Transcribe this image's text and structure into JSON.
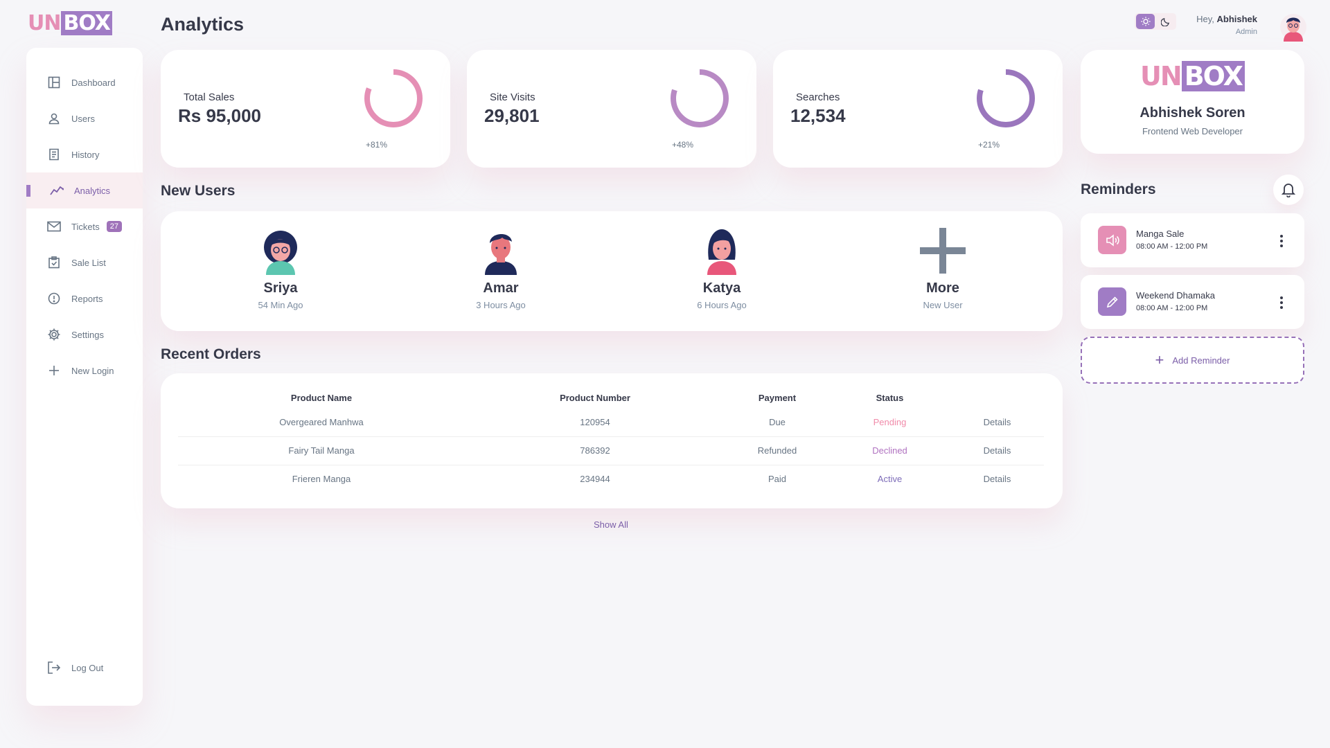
{
  "brand": {
    "un": "UN",
    "box": "BOX"
  },
  "sidebar": {
    "items": [
      {
        "label": "Dashboard",
        "icon": "dashboard-icon"
      },
      {
        "label": "Users",
        "icon": "user-icon"
      },
      {
        "label": "History",
        "icon": "receipt-icon"
      },
      {
        "label": "Analytics",
        "icon": "analytics-icon",
        "active": true
      },
      {
        "label": "Tickets",
        "icon": "mail-icon",
        "badge": "27"
      },
      {
        "label": "Sale List",
        "icon": "clipboard-icon"
      },
      {
        "label": "Reports",
        "icon": "report-icon"
      },
      {
        "label": "Settings",
        "icon": "gear-icon"
      },
      {
        "label": "New Login",
        "icon": "plus-icon"
      }
    ],
    "logout": "Log Out"
  },
  "page": {
    "title": "Analytics"
  },
  "stats": [
    {
      "label": "Total Sales",
      "value": "Rs 95,000",
      "percent": "+81%",
      "progress": 0.81,
      "color": "#e58fb5"
    },
    {
      "label": "Site Visits",
      "value": "29,801",
      "percent": "+48%",
      "progress": 0.8,
      "color": "#b88ac4"
    },
    {
      "label": "Searches",
      "value": "12,534",
      "percent": "+21%",
      "progress": 0.8,
      "color": "#9a76bd"
    }
  ],
  "new_users": {
    "title": "New Users",
    "items": [
      {
        "name": "Sriya",
        "time": "54 Min Ago"
      },
      {
        "name": "Amar",
        "time": "3 Hours Ago"
      },
      {
        "name": "Katya",
        "time": "6 Hours Ago"
      },
      {
        "name": "More",
        "time": "New User"
      }
    ]
  },
  "orders": {
    "title": "Recent Orders",
    "headers": [
      "Product Name",
      "Product Number",
      "Payment",
      "Status",
      ""
    ],
    "rows": [
      {
        "name": "Overgeared Manhwa",
        "number": "120954",
        "payment": "Due",
        "status": "Pending",
        "action": "Details"
      },
      {
        "name": "Fairy Tail Manga",
        "number": "786392",
        "payment": "Refunded",
        "status": "Declined",
        "action": "Details"
      },
      {
        "name": "Frieren Manga",
        "number": "234944",
        "payment": "Paid",
        "status": "Active",
        "action": "Details"
      }
    ],
    "show_all": "Show All"
  },
  "header": {
    "greeting": "Hey,",
    "user": "Abhishek",
    "role": "Admin"
  },
  "profile": {
    "name": "Abhishek Soren",
    "role": "Frontend Web Developer"
  },
  "reminders": {
    "title": "Reminders",
    "items": [
      {
        "title": "Manga Sale",
        "time": "08:00 AM - 12:00 PM",
        "icon": "volume-icon",
        "color": "#e58fb5"
      },
      {
        "title": "Weekend Dhamaka",
        "time": "08:00 AM - 12:00 PM",
        "icon": "edit-icon",
        "color": "#a07cc5"
      }
    ],
    "add_label": "Add Reminder"
  }
}
